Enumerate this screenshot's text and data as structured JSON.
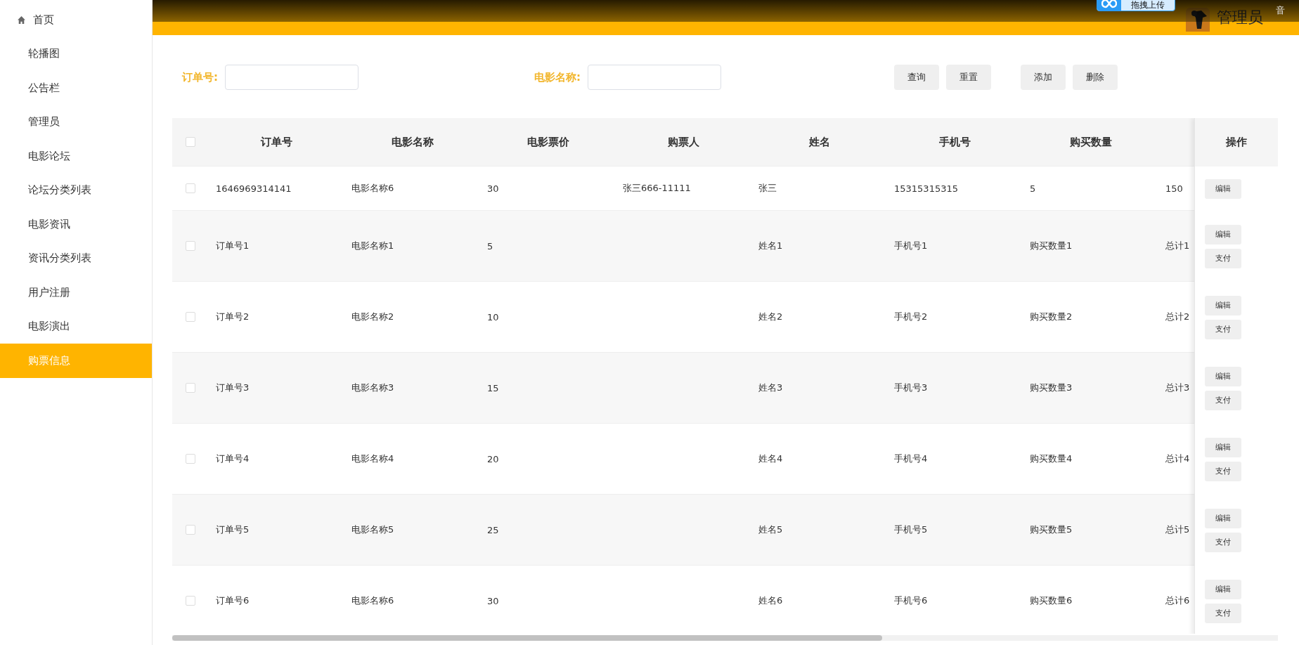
{
  "header": {
    "user": "管理员",
    "upload_badge": "拖拽上传",
    "corner_text": "音"
  },
  "sidebar": {
    "items": [
      {
        "label": "首页",
        "kind": "home",
        "selected": false
      },
      {
        "label": "轮播图",
        "kind": "link",
        "selected": false
      },
      {
        "label": "公告栏",
        "kind": "link",
        "selected": false
      },
      {
        "label": "管理员",
        "kind": "link",
        "selected": false
      },
      {
        "label": "电影论坛",
        "kind": "link",
        "selected": false
      },
      {
        "label": "论坛分类列表",
        "kind": "link",
        "selected": false
      },
      {
        "label": "电影资讯",
        "kind": "link",
        "selected": false
      },
      {
        "label": "资讯分类列表",
        "kind": "link",
        "selected": false
      },
      {
        "label": "用户注册",
        "kind": "link",
        "selected": false
      },
      {
        "label": "电影演出",
        "kind": "link",
        "selected": false
      },
      {
        "label": "购票信息",
        "kind": "link",
        "selected": true
      }
    ]
  },
  "search": {
    "fields": [
      {
        "label": "订单号:"
      },
      {
        "label": "电影名称:"
      }
    ],
    "button_groups": [
      [
        "查询",
        "重置"
      ],
      [
        "添加",
        "删除"
      ]
    ]
  },
  "table": {
    "header_checked": false,
    "columns": [
      "订单号",
      "电影名称",
      "电影票价",
      "购票人",
      "姓名",
      "手机号",
      "购买数量"
    ],
    "actions_header": "操作",
    "rows": [
      {
        "checked": false,
        "cells": [
          "1646969314141",
          "电影名称6",
          "30",
          "张三666-11111",
          "张三",
          "15315315315",
          "5",
          "150"
        ],
        "actions": [
          "编辑"
        ]
      },
      {
        "checked": false,
        "cells": [
          "订单号1",
          "电影名称1",
          "5",
          "",
          "姓名1",
          "手机号1",
          "购买数量1",
          "总计1"
        ],
        "actions": [
          "编辑",
          "支付"
        ]
      },
      {
        "checked": false,
        "cells": [
          "订单号2",
          "电影名称2",
          "10",
          "",
          "姓名2",
          "手机号2",
          "购买数量2",
          "总计2"
        ],
        "actions": [
          "编辑",
          "支付"
        ]
      },
      {
        "checked": false,
        "cells": [
          "订单号3",
          "电影名称3",
          "15",
          "",
          "姓名3",
          "手机号3",
          "购买数量3",
          "总计3"
        ],
        "actions": [
          "编辑",
          "支付"
        ]
      },
      {
        "checked": false,
        "cells": [
          "订单号4",
          "电影名称4",
          "20",
          "",
          "姓名4",
          "手机号4",
          "购买数量4",
          "总计4"
        ],
        "actions": [
          "编辑",
          "支付"
        ]
      },
      {
        "checked": false,
        "cells": [
          "订单号5",
          "电影名称5",
          "25",
          "",
          "姓名5",
          "手机号5",
          "购买数量5",
          "总计5"
        ],
        "actions": [
          "编辑",
          "支付"
        ]
      },
      {
        "checked": false,
        "cells": [
          "订单号6",
          "电影名称6",
          "30",
          "",
          "姓名6",
          "手机号6",
          "购买数量6",
          "总计6"
        ],
        "actions": [
          "编辑",
          "支付"
        ]
      }
    ]
  }
}
